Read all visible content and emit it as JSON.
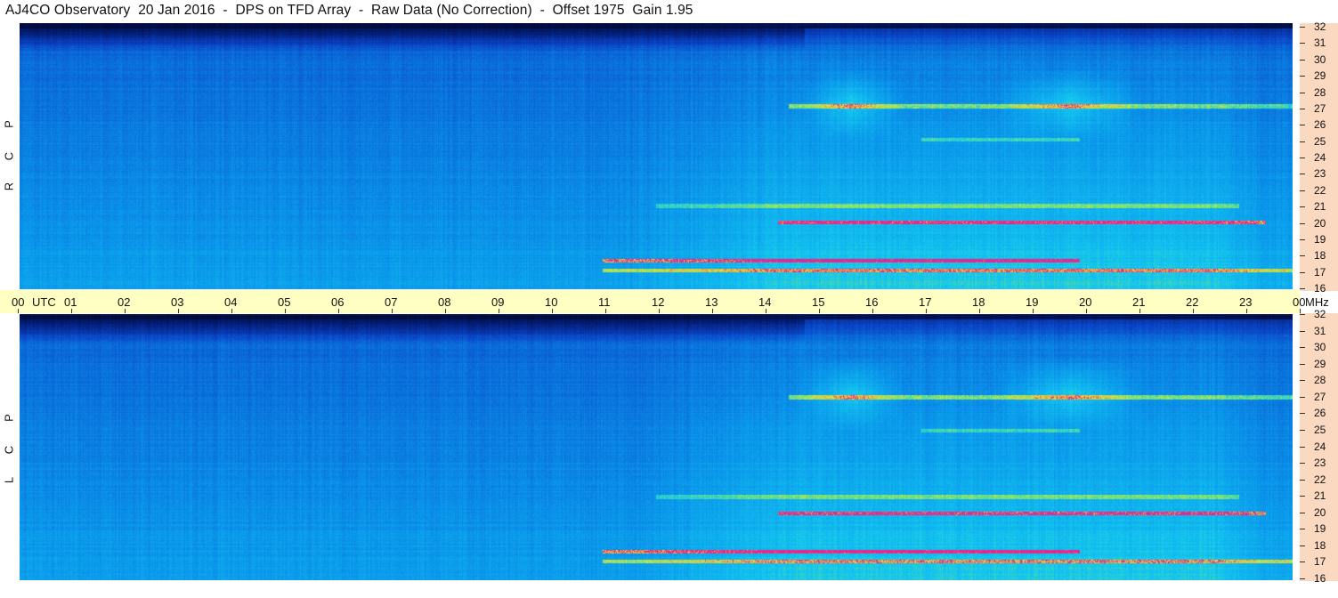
{
  "title": "AJ4CO Observatory  20 Jan 2016  -  DPS on TFD Array  -  Raw Data (No Correction)  -  Offset 1975  Gain 1.95",
  "panels": [
    {
      "polarization": [
        "R",
        "C",
        "P"
      ]
    },
    {
      "polarization": [
        "L",
        "C",
        "P"
      ]
    }
  ],
  "time_axis": {
    "ticks": [
      "00",
      "01",
      "02",
      "03",
      "04",
      "05",
      "06",
      "07",
      "08",
      "09",
      "10",
      "11",
      "12",
      "13",
      "14",
      "15",
      "16",
      "17",
      "18",
      "19",
      "20",
      "21",
      "22",
      "23",
      "00"
    ],
    "unit": "UTC"
  },
  "freq_axis": {
    "ticks": [
      "32",
      "31",
      "30",
      "29",
      "28",
      "27",
      "26",
      "25",
      "24",
      "23",
      "22",
      "21",
      "20",
      "19",
      "18",
      "17",
      "16"
    ],
    "unit": "MHz"
  },
  "colors": {
    "time_axis_bg": "#ffffc4",
    "freq_axis_bg": "#fbd8c0",
    "cold": "#000a3c",
    "base": "#0a46c8",
    "mid": "#0ab4f0",
    "warm": "#aaf050",
    "hot": "#f0d23c",
    "peak": "#e02890"
  },
  "chart_data": {
    "type": "heatmap",
    "title": "AJ4CO Observatory  20 Jan 2016  -  DPS on TFD Array  -  Raw Data (No Correction)  -  Offset 1975  Gain 1.95",
    "xlabel": "UTC",
    "ylabel": "MHz",
    "xlim": [
      0,
      24
    ],
    "ylim": [
      16,
      32
    ],
    "panels": [
      "RCP",
      "LCP"
    ],
    "colormap": [
      "#000a3c",
      "#0a46c8",
      "#0ab4f0",
      "#aaf050",
      "#f0d23c",
      "#e02890"
    ],
    "features": [
      {
        "freq_mhz": 27,
        "start_utc": 14.5,
        "end_utc": 24,
        "intensity": "high"
      },
      {
        "freq_mhz": 17.7,
        "start_utc": 11,
        "end_utc": 20,
        "intensity": "peak"
      },
      {
        "freq_mhz": 17.1,
        "start_utc": 11,
        "end_utc": 24,
        "intensity": "high"
      },
      {
        "freq_mhz": 20,
        "start_utc": 14.3,
        "end_utc": 23.5,
        "intensity": "peak"
      },
      {
        "freq_mhz": 21,
        "start_utc": 12,
        "end_utc": 23,
        "intensity": "medium"
      },
      {
        "freq_mhz": 25,
        "start_utc": 17,
        "end_utc": 20,
        "intensity": "medium"
      }
    ]
  }
}
